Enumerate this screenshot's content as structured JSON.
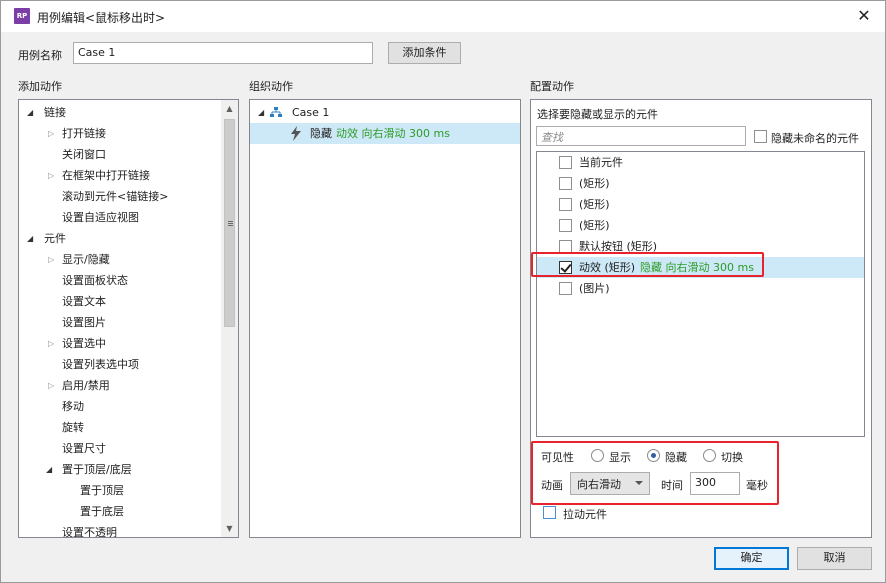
{
  "window": {
    "title": "用例编辑<鼠标移出时>",
    "app_icon": "RP",
    "close": "✕"
  },
  "case_name": {
    "label": "用例名称",
    "value": "Case 1",
    "add_condition": "添加条件"
  },
  "add_actions": {
    "heading": "添加动作",
    "items": [
      {
        "label": "链接"
      },
      {
        "label": "打开链接"
      },
      {
        "label": "关闭窗口"
      },
      {
        "label": "在框架中打开链接"
      },
      {
        "label": "滚动到元件<锚链接>"
      },
      {
        "label": "设置自适应视图"
      },
      {
        "label": "元件"
      },
      {
        "label": "显示/隐藏"
      },
      {
        "label": "设置面板状态"
      },
      {
        "label": "设置文本"
      },
      {
        "label": "设置图片"
      },
      {
        "label": "设置选中"
      },
      {
        "label": "设置列表选中项"
      },
      {
        "label": "启用/禁用"
      },
      {
        "label": "移动"
      },
      {
        "label": "旋转"
      },
      {
        "label": "设置尺寸"
      },
      {
        "label": "置于顶层/底层"
      },
      {
        "label": "置于顶层"
      },
      {
        "label": "置于底层"
      },
      {
        "label": "设置不透明"
      }
    ]
  },
  "organize_actions": {
    "heading": "组织动作",
    "case_label": "Case 1",
    "action_verb": "隐藏",
    "action_detail": "动效 向右滑动 300 ms"
  },
  "configure_actions": {
    "heading": "配置动作",
    "select_prompt": "选择要隐藏或显示的元件",
    "search_placeholder": "查找",
    "hide_unnamed": "隐藏未命名的元件",
    "widgets": [
      {
        "label": "当前元件",
        "checked": false
      },
      {
        "label": "(矩形)",
        "checked": false
      },
      {
        "label": "(矩形)",
        "checked": false
      },
      {
        "label": "(矩形)",
        "checked": false
      },
      {
        "label": "默认按钮 (矩形)",
        "checked": false
      },
      {
        "label": "动效 (矩形)",
        "status": "隐藏 向右滑动 300 ms",
        "checked": true
      },
      {
        "label": "(图片)",
        "checked": false
      }
    ],
    "visibility_label": "可见性",
    "options": {
      "show": "显示",
      "hide": "隐藏",
      "toggle": "切换"
    },
    "selected_option": "hide",
    "animation_label": "动画",
    "animation_value": "向右滑动",
    "time_label": "时间",
    "time_value": "300",
    "time_unit": "毫秒",
    "push_widgets": "拉动元件"
  },
  "footer": {
    "ok": "确定",
    "cancel": "取消"
  },
  "colors": {
    "highlight_red": "#e8232c",
    "selection_blue": "#cde8f6",
    "status_green": "#2e9c27",
    "app_icon_purple": "#7b3ea6"
  }
}
